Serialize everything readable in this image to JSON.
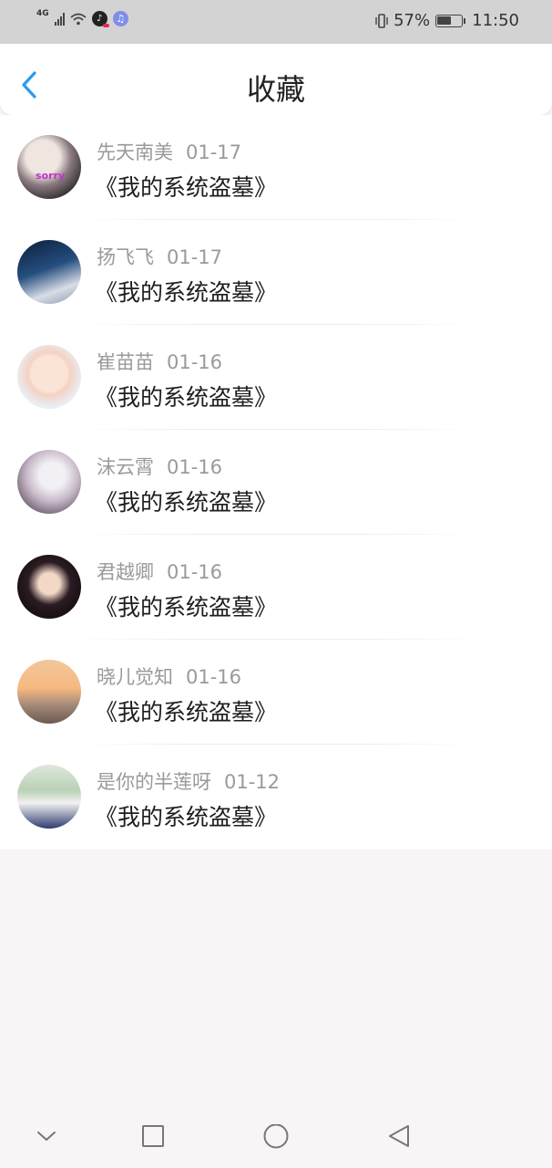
{
  "status_bar": {
    "network": "4G",
    "battery_percent": "57%",
    "time": "11:50"
  },
  "header": {
    "title": "收藏"
  },
  "favorites": [
    {
      "user": "先天南美",
      "date": "01-17",
      "book": "《我的系统盗墓》",
      "avatar_text": "sorry"
    },
    {
      "user": "扬飞飞",
      "date": "01-17",
      "book": "《我的系统盗墓》"
    },
    {
      "user": "崔苗苗",
      "date": "01-16",
      "book": "《我的系统盗墓》"
    },
    {
      "user": "沫云霄",
      "date": "01-16",
      "book": "《我的系统盗墓》"
    },
    {
      "user": "君越卿",
      "date": "01-16",
      "book": "《我的系统盗墓》"
    },
    {
      "user": "晓儿觉知",
      "date": "01-16",
      "book": "《我的系统盗墓》"
    },
    {
      "user": "是你的半莲呀",
      "date": "01-12",
      "book": "《我的系统盗墓》"
    }
  ],
  "colors": {
    "accent": "#2a9bf0",
    "meta_text": "#9a9a9a",
    "title_text": "#222222",
    "status_bar_bg": "#d3d3d3"
  }
}
